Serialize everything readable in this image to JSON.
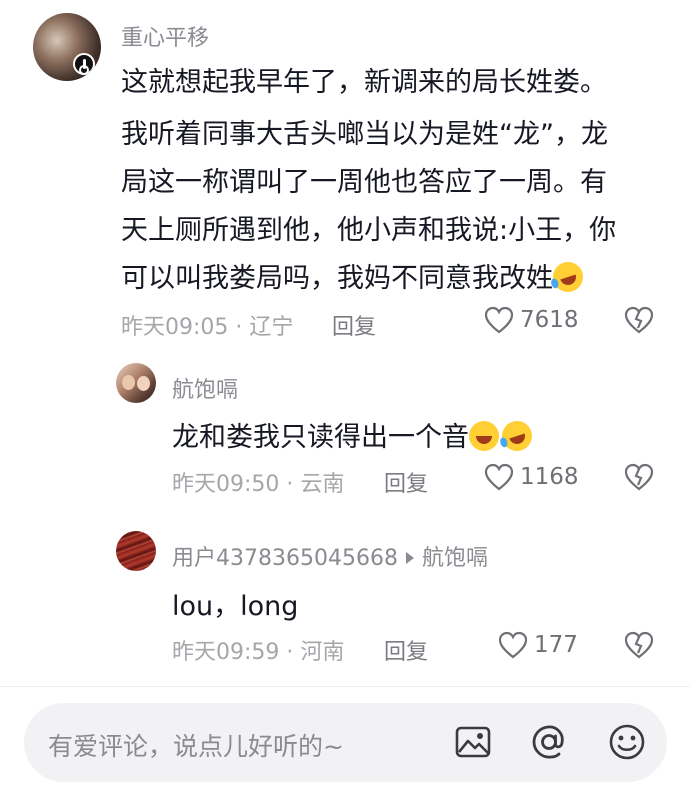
{
  "comments": [
    {
      "username": "重心平移",
      "lines": [
        "这就想起我早年了，新调来的局长姓娄。",
        "我听着同事大舌头啷当以为是姓“龙”，龙",
        "局这一称谓叫了一周他也答应了一周。有",
        "天上厕所遇到他，他小声和我说:小王，你",
        "可以叫我娄局吗，我妈不同意我改姓"
      ],
      "emojis": [
        "rolling-laughing-emoji"
      ],
      "time_location": "昨天09:05 · 辽宁",
      "reply_label": "回复",
      "likes": "7618"
    }
  ],
  "replies": [
    {
      "username": "航饱嗝",
      "text": "龙和娄我只读得出一个音",
      "emojis": [
        "sweat-smile-emoji",
        "rolling-laughing-emoji"
      ],
      "time_location": "昨天09:50 · 云南",
      "reply_label": "回复",
      "likes": "1168"
    },
    {
      "username": "用户4378365045668",
      "reply_to": "航饱嗝",
      "text": "lou，long",
      "time_location": "昨天09:59 · 河南",
      "reply_label": "回复",
      "likes": "177"
    }
  ],
  "input_bar": {
    "placeholder": "有爱评论，说点儿好听的~",
    "icons": [
      "image-icon",
      "mention-icon",
      "emoji-icon"
    ]
  },
  "colors": {
    "text": "#161823",
    "secondary": "#8a8b91",
    "input_bg": "#f2f2f4"
  }
}
